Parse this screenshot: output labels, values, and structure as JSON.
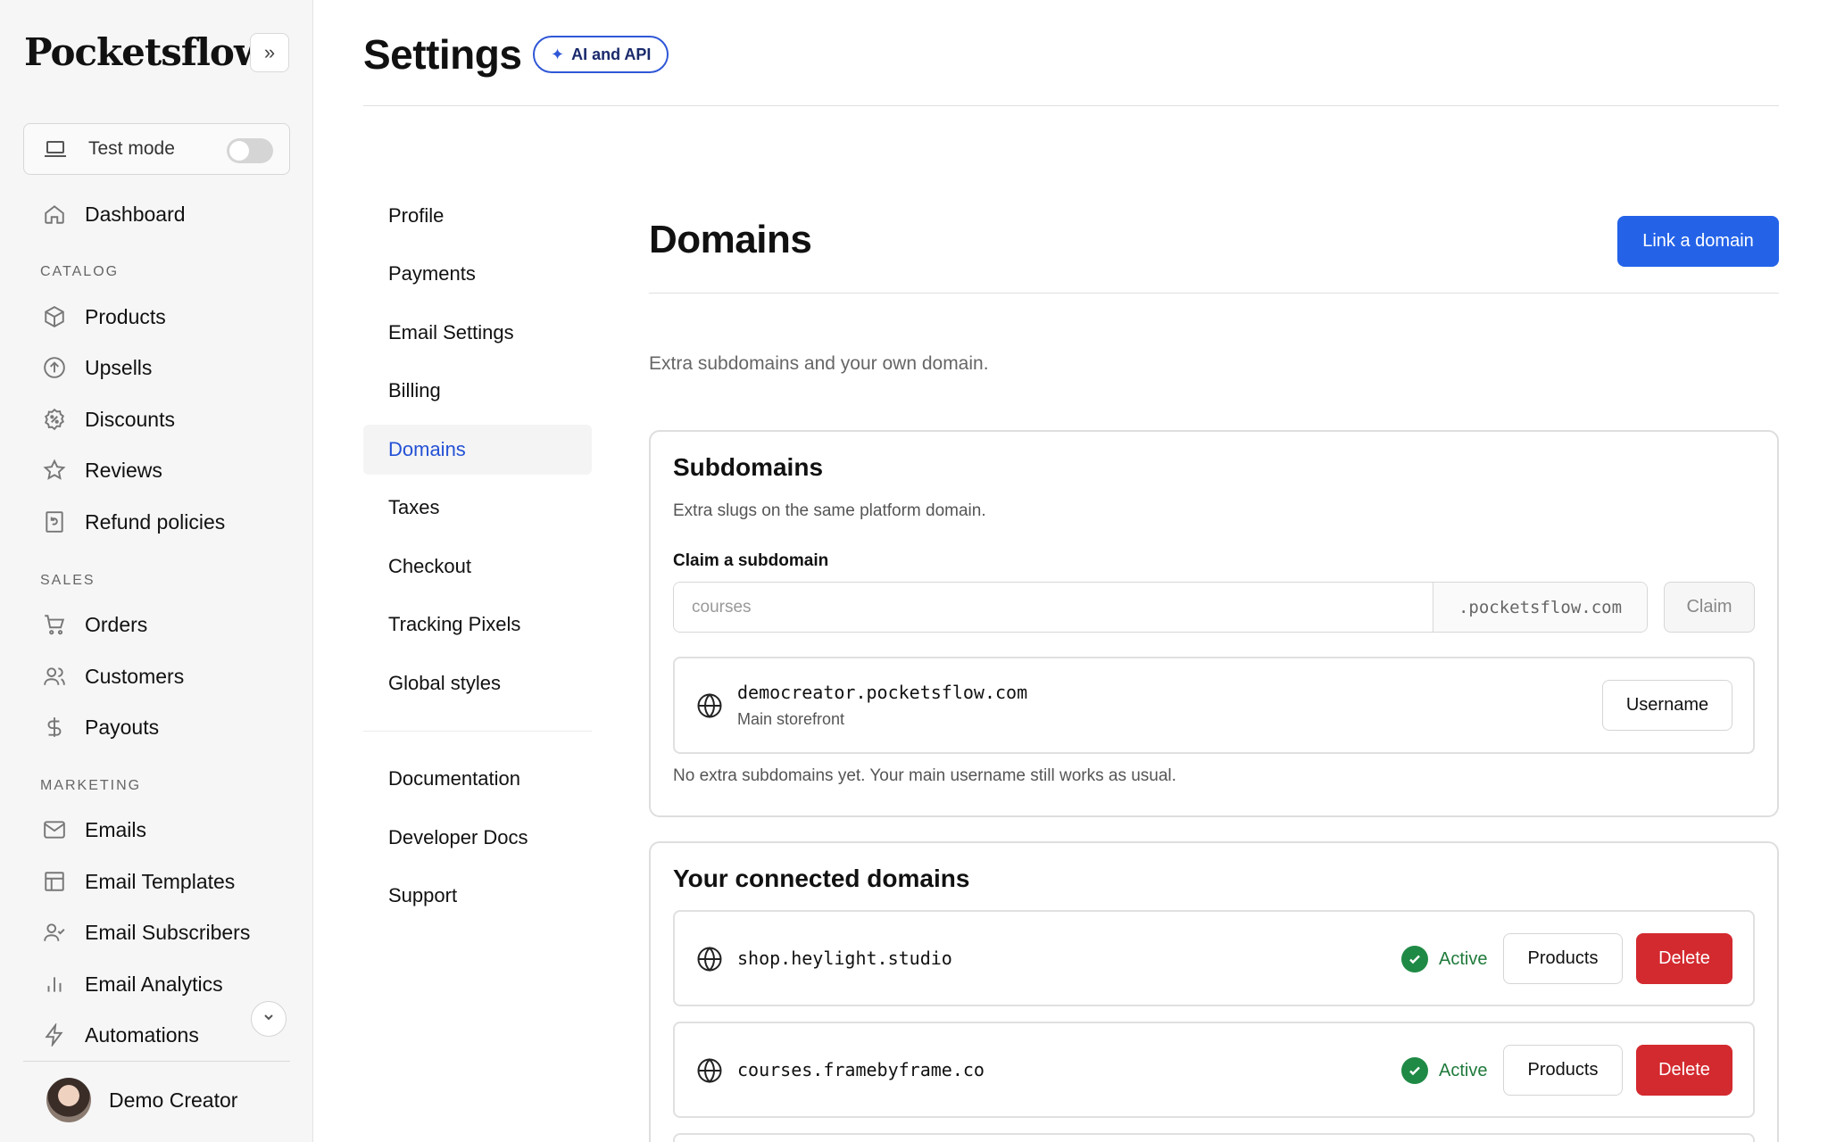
{
  "sidebar": {
    "brand": "Pocketsflow",
    "test_mode": {
      "label": "Test mode",
      "enabled": false
    },
    "dashboard": "Dashboard",
    "sections": {
      "catalog": "CATALOG",
      "sales": "SALES",
      "marketing": "MARKETING"
    },
    "catalog_items": [
      "Products",
      "Upsells",
      "Discounts",
      "Reviews",
      "Refund policies"
    ],
    "sales_items": [
      "Orders",
      "Customers",
      "Payouts"
    ],
    "marketing_items": [
      "Emails",
      "Email Templates",
      "Email Subscribers",
      "Email Analytics",
      "Automations"
    ],
    "user": {
      "name": "Demo Creator"
    }
  },
  "header": {
    "title": "Settings",
    "badge": "AI and API"
  },
  "settings_nav": {
    "items": [
      "Profile",
      "Payments",
      "Email Settings",
      "Billing",
      "Domains",
      "Taxes",
      "Checkout",
      "Tracking Pixels",
      "Global styles"
    ],
    "active": "Domains",
    "secondary": [
      "Documentation",
      "Developer Docs",
      "Support"
    ]
  },
  "main": {
    "title": "Domains",
    "link_button": "Link a domain",
    "description": "Extra subdomains and your own domain.",
    "subdomains": {
      "title": "Subdomains",
      "subtitle": "Extra slugs on the same platform domain.",
      "claim_label": "Claim a subdomain",
      "input_placeholder": "courses",
      "suffix": ".pocketsflow.com",
      "claim_button": "Claim",
      "main": {
        "domain": "democreator.pocketsflow.com",
        "note": "Main storefront",
        "button": "Username"
      },
      "empty_note": "No extra subdomains yet. Your main username still works as usual."
    },
    "connected": {
      "title": "Your connected domains",
      "domains": [
        {
          "domain": "shop.heylight.studio",
          "status": "Active",
          "products_button": "Products",
          "delete_button": "Delete"
        },
        {
          "domain": "courses.framebyframe.co",
          "status": "Active",
          "products_button": "Products",
          "delete_button": "Delete"
        }
      ]
    }
  },
  "colors": {
    "accent": "#2463e8",
    "danger": "#d32a2f",
    "success": "#1f8a45"
  }
}
